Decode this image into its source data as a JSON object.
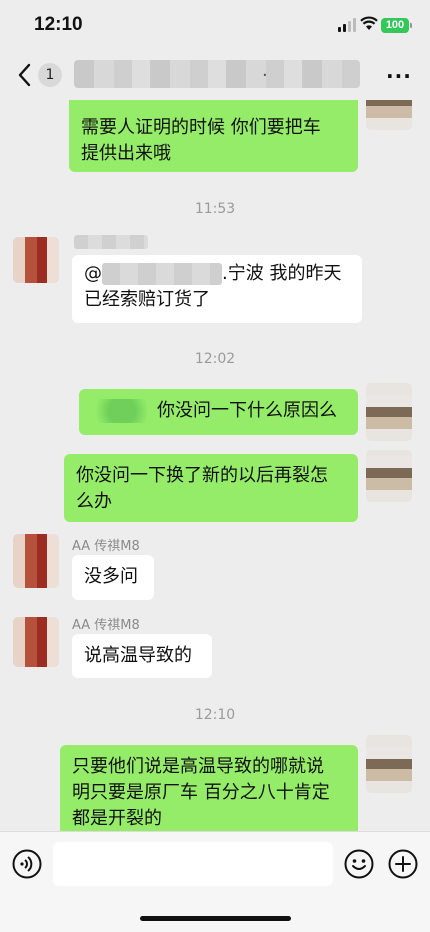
{
  "status": {
    "time": "12:10",
    "battery": "100"
  },
  "nav": {
    "unread_count": "1",
    "title_suffix": ".",
    "more": "···"
  },
  "messages": {
    "m1_line1": "需要人证明的时候 你们要把车",
    "m1_line2": "提供出来哦",
    "ts1": "11:53",
    "m2_line1_prefix": "@",
    "m2_line1_suffix": ".宁波 我的昨天",
    "m2_line2": "已经索赔订货了",
    "ts2": "12:02",
    "m3": "你没问一下什么原因么",
    "m4_line1": "你没问一下换了新的以后再裂怎",
    "m4_line2": "么办",
    "sender1": "AA 传祺M8",
    "m5": "没多问",
    "sender2": "AA 传祺M8",
    "m6": "说高温导致的",
    "ts3": "12:10",
    "m7_line1": "只要他们说是高温导致的哪就说",
    "m7_line2": "明只要是原厂车 百分之八十肯定",
    "m7_line3": "都是开裂的"
  },
  "input": {
    "placeholder": ""
  },
  "colors": {
    "outgoing_bubble": "#95ec69",
    "incoming_bubble": "#ffffff",
    "background": "#ededed",
    "battery": "#34c759"
  },
  "icons": [
    "back-chevron-icon",
    "more-icon",
    "voice-icon",
    "emoji-icon",
    "add-icon"
  ]
}
